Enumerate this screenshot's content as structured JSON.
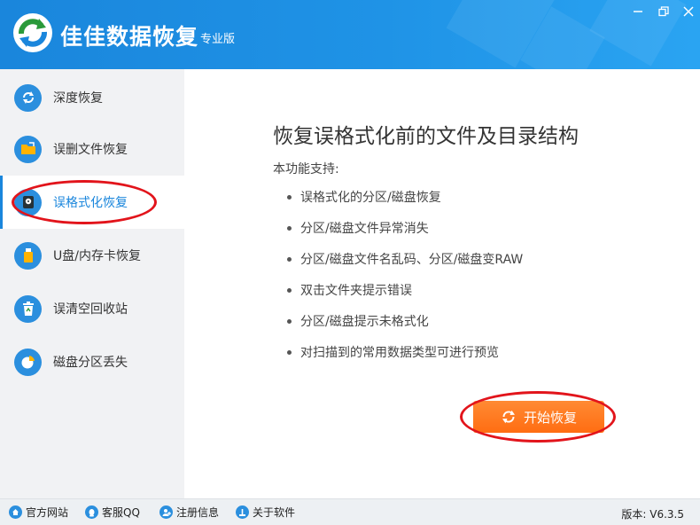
{
  "app": {
    "title": "佳佳数据恢复",
    "edition": "专业版",
    "accent_color": "#1a86dc",
    "action_color": "#ff7a22",
    "annotation_color": "#e2141b"
  },
  "window_controls": [
    {
      "name": "minimize-icon"
    },
    {
      "name": "restore-icon"
    },
    {
      "name": "close-icon"
    }
  ],
  "sidebar": {
    "items": [
      {
        "label": "深度恢复",
        "icon": "deep-recovery-icon",
        "active": false
      },
      {
        "label": "误删文件恢复",
        "icon": "folder-icon",
        "active": false
      },
      {
        "label": "误格式化恢复",
        "icon": "disk-icon",
        "active": true
      },
      {
        "label": "U盘/内存卡恢复",
        "icon": "usb-drive-icon",
        "active": false
      },
      {
        "label": "误清空回收站",
        "icon": "recycle-bin-icon",
        "active": false
      },
      {
        "label": "磁盘分区丢失",
        "icon": "pie-partition-icon",
        "active": false
      }
    ]
  },
  "main": {
    "title": "恢复误格式化前的文件及目录结构",
    "support_label": "本功能支持:",
    "features": [
      "误格式化的分区/磁盘恢复",
      "分区/磁盘文件异常消失",
      "分区/磁盘文件名乱码、分区/磁盘变RAW",
      "双击文件夹提示错误",
      "分区/磁盘提示未格式化",
      "对扫描到的常用数据类型可进行预览"
    ],
    "start_button": "开始恢复"
  },
  "footer": {
    "links": [
      {
        "label": "官方网站",
        "icon": "home-icon"
      },
      {
        "label": "客服QQ",
        "icon": "qq-icon"
      },
      {
        "label": "注册信息",
        "icon": "register-user-icon"
      },
      {
        "label": "关于软件",
        "icon": "info-icon"
      }
    ],
    "version": "版本: V6.3.5"
  }
}
